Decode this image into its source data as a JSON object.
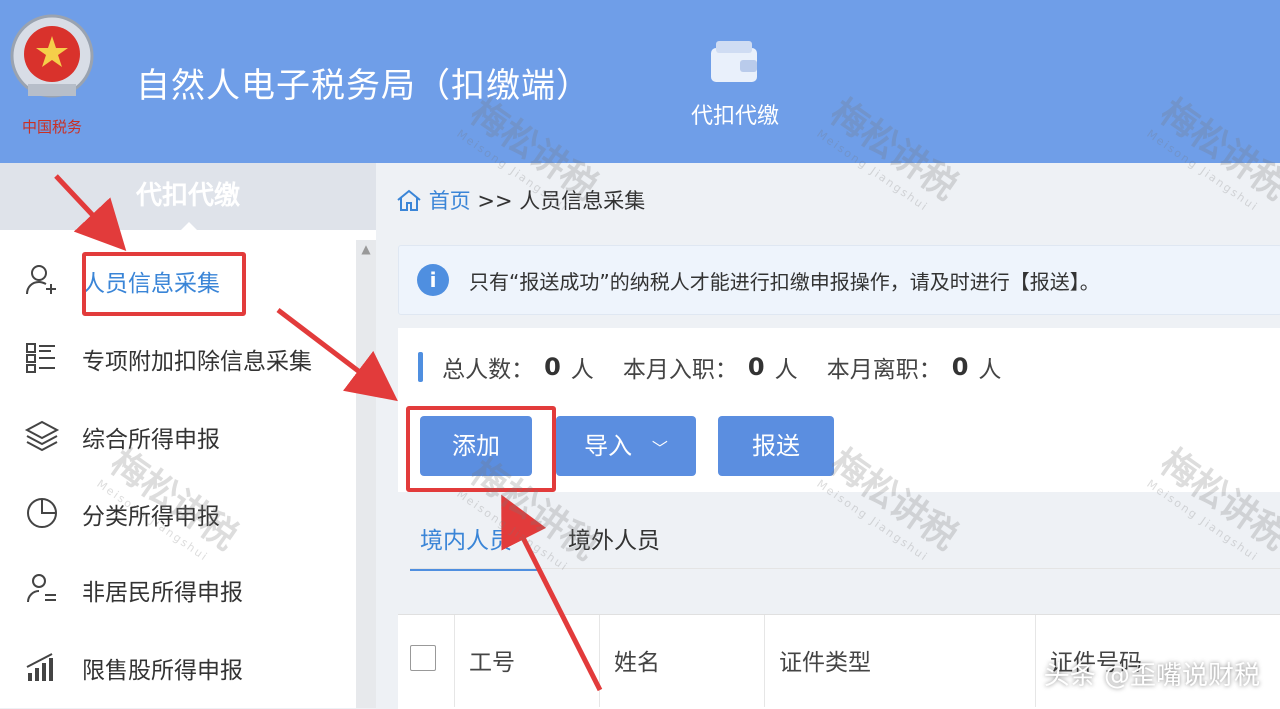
{
  "header": {
    "app_title": "自然人电子税务局（扣缴端）",
    "top_nav_label": "代扣代缴",
    "logo_text": "中国税务"
  },
  "sidebar": {
    "title": "代扣代缴",
    "items": [
      {
        "label": "人员信息采集",
        "icon": "add-user-icon",
        "active": true
      },
      {
        "label": "专项附加扣除信息采集",
        "icon": "list-icon",
        "active": false
      },
      {
        "label": "综合所得申报",
        "icon": "layers-icon",
        "active": false
      },
      {
        "label": "分类所得申报",
        "icon": "pie-chart-icon",
        "active": false
      },
      {
        "label": "非居民所得申报",
        "icon": "user-list-icon",
        "active": false
      },
      {
        "label": "限售股所得申报",
        "icon": "bar-chart-icon",
        "active": false
      }
    ]
  },
  "breadcrumb": {
    "home": "首页",
    "separator": ">>",
    "current": "人员信息采集"
  },
  "notice": {
    "icon": "info-icon",
    "text": "只有“报送成功”的纳税人才能进行扣缴申报操作，请及时进行【报送】。"
  },
  "stats": {
    "total_label": "总人数：",
    "total_value": "0",
    "unit": "人",
    "join_label": "本月入职：",
    "join_value": "0",
    "leave_label": "本月离职：",
    "leave_value": "0"
  },
  "toolbar": {
    "add_label": "添加",
    "import_label": "导入",
    "submit_label": "报送"
  },
  "tabs": [
    "境内人员",
    "境外人员"
  ],
  "table": {
    "columns": [
      "工号",
      "姓名",
      "证件类型",
      "证件号码"
    ]
  },
  "watermark": {
    "text": "梅松讲税",
    "sub": "Meisong Jiangshui"
  },
  "corner_text": "头条 @歪嘴说财税",
  "colors": {
    "header_bg": "#6f9ee8",
    "accent": "#4f8fe0",
    "annotation_red": "#e23b3b"
  }
}
